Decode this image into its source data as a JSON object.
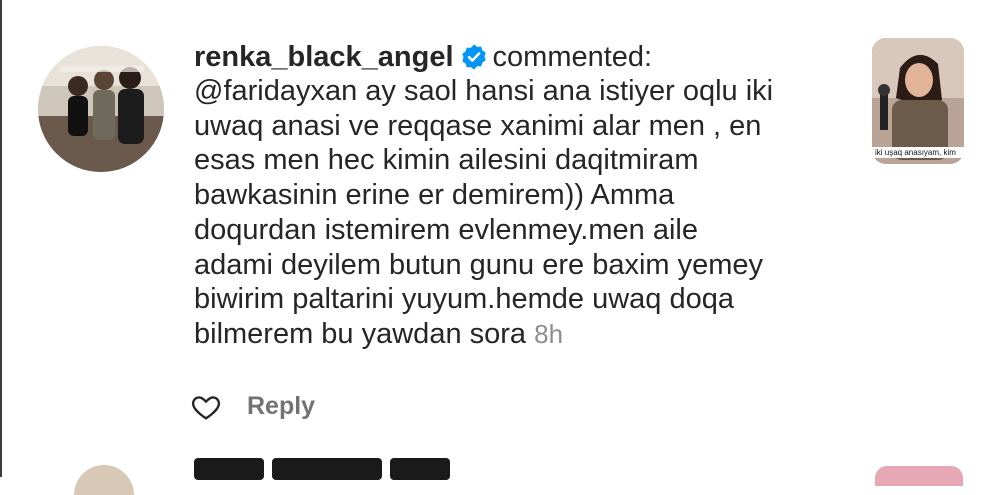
{
  "comment": {
    "username": "renka_black_angel",
    "verified": true,
    "action": "commented:",
    "body_lines": [
      "@faridayxan ay saol hansi ana istiyer oqlu iki",
      "uwaq anasi ve reqqase xanimi alar men , en",
      "esas men hec kimin ailesini daqitmiram",
      "bawkasinin erine er demirem)) Amma",
      "doqurdan istemirem evlenmey.men aile",
      "adami deyilem butun gunu ere baxim yemey",
      "biwirim paltarini yuyum.hemde uwaq doqa",
      "bilmerem bu yawdan sora"
    ],
    "timestamp": "8h",
    "reply_label": "Reply"
  },
  "thumbnail": {
    "caption": "iki uşaq anasıyam, kim"
  },
  "icons": {
    "like": "heart-outline-icon",
    "verified": "verified-badge-icon"
  },
  "colors": {
    "verified_blue": "#0095f6",
    "text": "#262626",
    "secondary": "#8e8e8e"
  }
}
